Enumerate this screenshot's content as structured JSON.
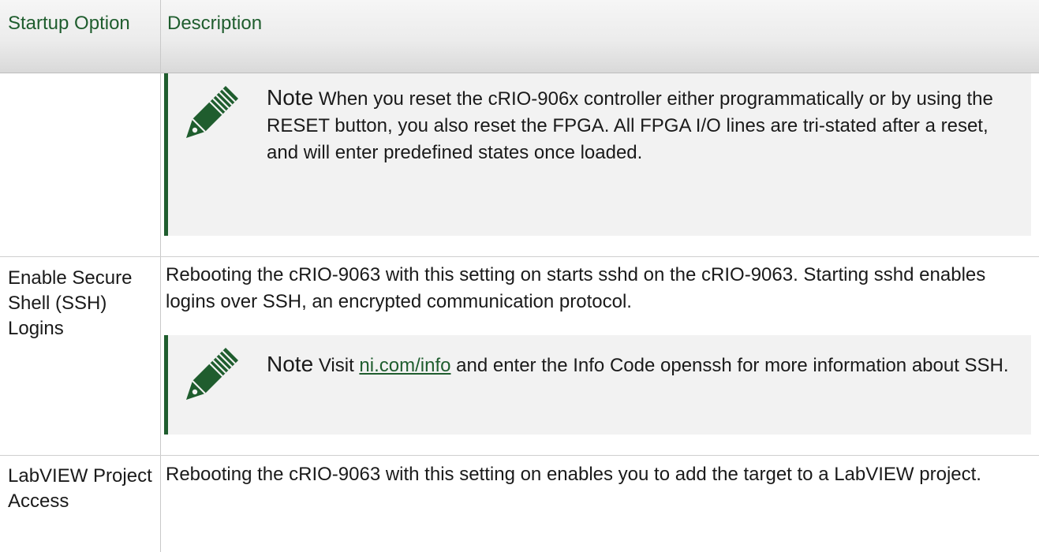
{
  "header": {
    "col1": "Startup Option",
    "col2": "Description"
  },
  "rows": [
    {
      "note": {
        "label": "Note",
        "text": " When you reset the cRIO-906x controller either programmatically or by using the RESET button, you also reset the FPGA. All FPGA I/O lines are tri-stated after a reset, and will enter predefined states once loaded."
      }
    },
    {
      "option": "Enable Secure Shell (SSH) Logins",
      "description": "Rebooting the cRIO-9063 with this setting on starts sshd on the cRIO-9063. Starting sshd enables logins over SSH, an encrypted communication protocol.",
      "note": {
        "label": "Note",
        "pre": " Visit ",
        "link": "ni.com/info",
        "post": " and enter the Info Code openssh for more information about SSH."
      }
    },
    {
      "option": "LabVIEW Project Access",
      "description": "Rebooting the cRIO-9063 with this setting on enables you to add the target to a LabVIEW project."
    }
  ],
  "icons": {
    "note_icon": "pencil-icon"
  },
  "colors": {
    "accent_green": "#1f5d2e",
    "note_background": "#f2f2f2"
  }
}
